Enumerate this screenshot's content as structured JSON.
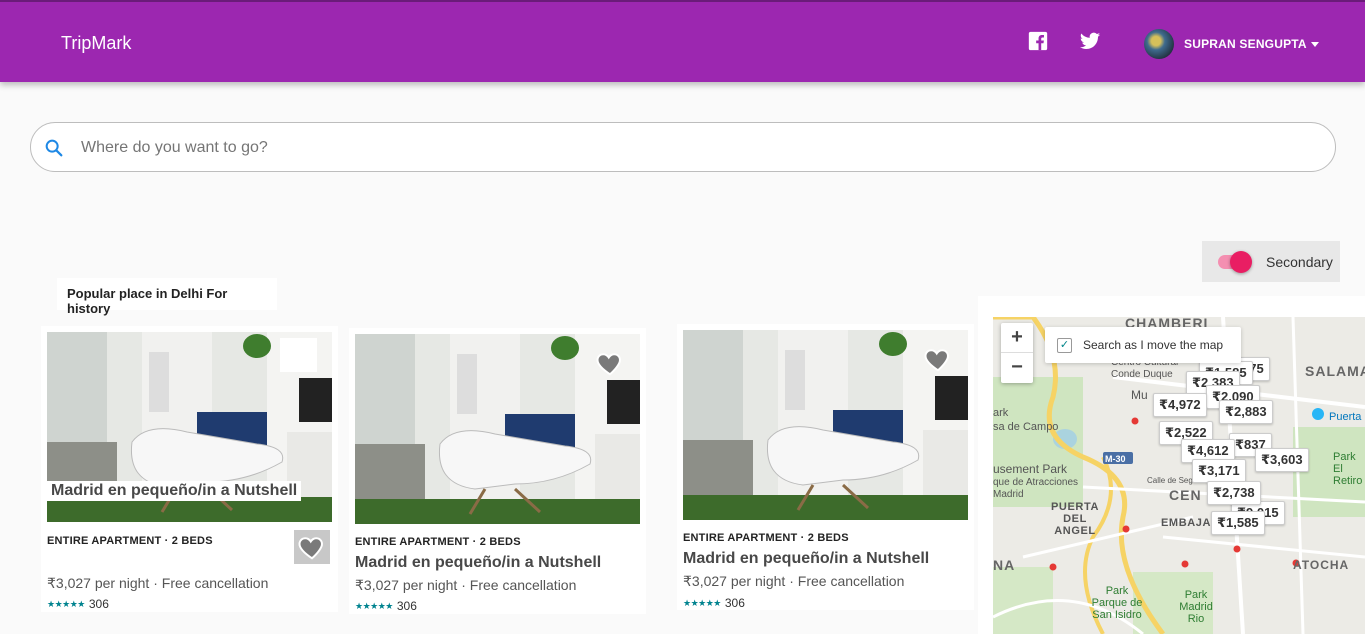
{
  "appbar": {
    "brand": "TripMark",
    "user_name": "SUPRAN SENGUPTA",
    "icons": [
      "facebook-icon",
      "twitter-icon"
    ]
  },
  "search": {
    "placeholder": "Where do you want to go?"
  },
  "toggle": {
    "label": "Secondary",
    "on": true
  },
  "section": {
    "title": "Popular place in Delhi For history"
  },
  "listings": [
    {
      "meta": "ENTIRE APARTMENT · 2 BEDS",
      "title": "Madrid en pequeño/in a Nutshell",
      "price": "₹3,027",
      "price_suffix": "per night · Free cancellation",
      "stars": "★★★★★",
      "reviews": "306"
    },
    {
      "meta": "ENTIRE APARTMENT · 2 BEDS",
      "title": "Madrid en pequeño/in a Nutshell",
      "price": "₹3,027",
      "price_suffix": "per night · Free cancellation",
      "stars": "★★★★★",
      "reviews": "306"
    },
    {
      "meta": "ENTIRE APARTMENT · 2 BEDS",
      "title": "Madrid en pequeño/in a Nutshell",
      "price": "₹3,027",
      "price_suffix": "per night · Free cancellation",
      "stars": "★★★★★",
      "reviews": "306"
    }
  ],
  "map": {
    "zoom_in": "+",
    "zoom_out": "−",
    "search_as_move": "Search as I move the map",
    "labels": {
      "chamberi": "CHAMBERI",
      "salamanca": "SALAMANCA",
      "centro_cultural": "Centro Cultural Conde Duque",
      "park_left": "ark",
      "casa_campo": "sa de Campo",
      "m30": "M-30",
      "amusement": "usement Park",
      "atracciones": "que de Atracciones Madrid",
      "puerta": "PUERTA DEL ANGEL",
      "calle": "Calle de Segovia",
      "centro": "CEN",
      "embajadores": "EMBAJADOR",
      "puerta_right": "Puerta",
      "park_retiro": "Park El Retiro",
      "na": "NA",
      "atocha": "ATOCHA",
      "park_san_isidro": "Park Parque de San Isidro",
      "park_madrid_rio": "Park Madrid Rio",
      "mu": "Mu"
    },
    "price_pins": [
      "₹1,585",
      "₹675",
      "₹2,383",
      "₹4,972",
      "₹2,090",
      "₹2,883",
      "₹2,522",
      "₹4,612",
      "₹837",
      "₹3,603",
      "₹3,171",
      "₹2,738",
      "₹9,015",
      "₹1,585"
    ]
  }
}
